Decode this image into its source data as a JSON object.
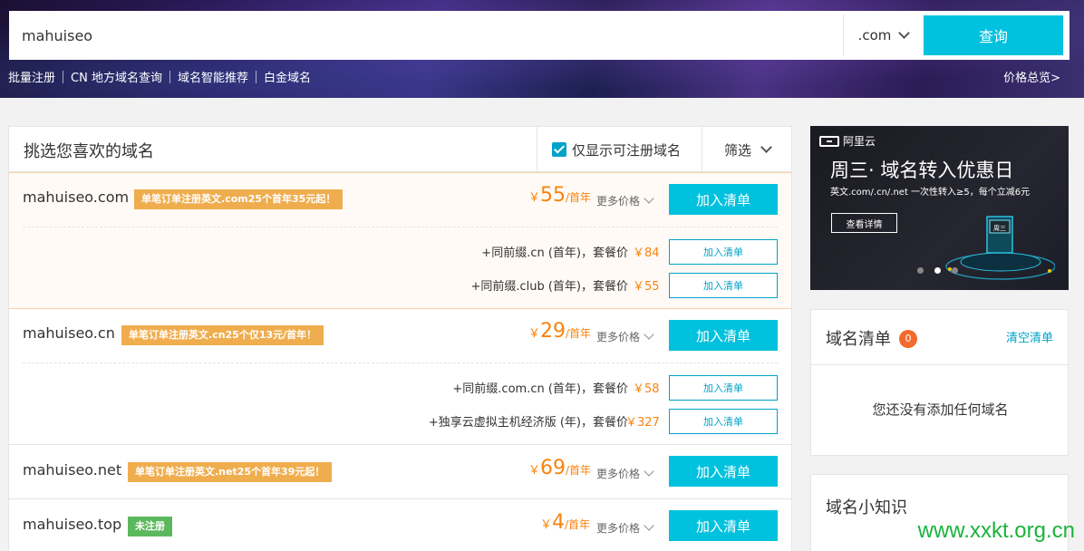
{
  "search": {
    "value": "mahuiseo",
    "tld": ".com",
    "button": "查询"
  },
  "subnav": {
    "items": [
      "批量注册",
      "CN 地方域名查询",
      "域名智能推荐",
      "白金域名"
    ],
    "price_overview": "价格总览>"
  },
  "panel": {
    "title": "挑选您喜欢的域名",
    "only_available": "仅显示可注册域名",
    "filter": "筛选"
  },
  "results": [
    {
      "domain": "mahuiseo.com",
      "promo": "单笔订单注册英文.com25个首年35元起！",
      "currency": "￥",
      "price": "55",
      "unit": "/首年",
      "more": "更多价格",
      "add": "加入清单",
      "bundles": [
        {
          "label": "+同前缀.cn (首年)，套餐价",
          "price": "￥84",
          "add": "加入清单"
        },
        {
          "label": "+同前缀.club (首年)，套餐价",
          "price": "￥55",
          "add": "加入清单"
        }
      ]
    },
    {
      "domain": "mahuiseo.cn",
      "promo": "单笔订单注册英文.cn25个仅13元/首年！",
      "currency": "￥",
      "price": "29",
      "unit": "/首年",
      "more": "更多价格",
      "add": "加入清单",
      "bundles": [
        {
          "label": "+同前缀.com.cn (首年)，套餐价",
          "price": "￥58",
          "add": "加入清单"
        },
        {
          "label": "+独享云虚拟主机经济版 (年)，套餐价",
          "price": "￥327",
          "add": "加入清单"
        }
      ]
    },
    {
      "domain": "mahuiseo.net",
      "promo": "单笔订单注册英文.net25个首年39元起！",
      "currency": "￥",
      "price": "69",
      "unit": "/首年",
      "more": "更多价格",
      "add": "加入清单"
    },
    {
      "domain": "mahuiseo.top",
      "promo": "未注册",
      "currency": "￥",
      "price": "4",
      "unit": "/首年",
      "more": "更多价格",
      "add": "加入清单"
    }
  ],
  "ad": {
    "logo": "阿里云",
    "title": "周三· 域名转入优惠日",
    "subtitle": "英文.com/.cn/.net 一次性转入≥5，每个立减6元",
    "button": "查看详情",
    "badge": "周三"
  },
  "cart": {
    "title": "域名清单",
    "count": "0",
    "clear": "清空清单",
    "empty": "您还没有添加任何域名"
  },
  "knowledge": {
    "title": "域名小知识"
  },
  "watermark": "www.xxkt.org.cn",
  "colors": {
    "accent": "#00c1de",
    "price": "#f7830f",
    "promo": "#f0ad4e",
    "available": "#5cb85c",
    "badge": "#f36a2c"
  }
}
